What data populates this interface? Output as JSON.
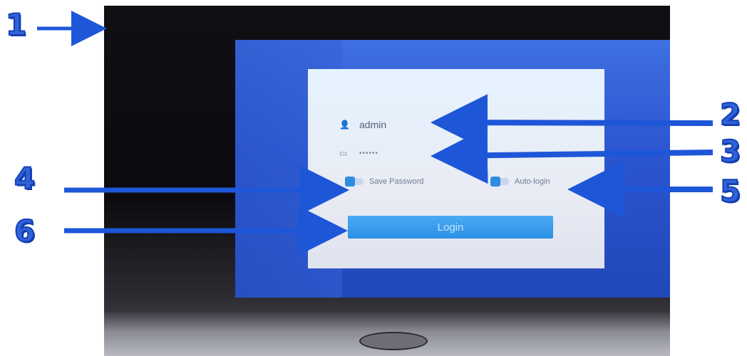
{
  "annotations": {
    "one": "1",
    "two": "2",
    "three": "3",
    "four": "4",
    "five": "5",
    "six": "6"
  },
  "login": {
    "username": "admin",
    "password_mask": "••••••",
    "save_password_label": "Save Password",
    "auto_login_label": "Auto-login",
    "login_button": "Login"
  },
  "icons": {
    "username": "user-icon",
    "password": "lock-icon"
  },
  "colors": {
    "annotation_blue": "#2f63d8",
    "screen_blue": "#2b55d0",
    "button_blue": "#3a9df0"
  }
}
